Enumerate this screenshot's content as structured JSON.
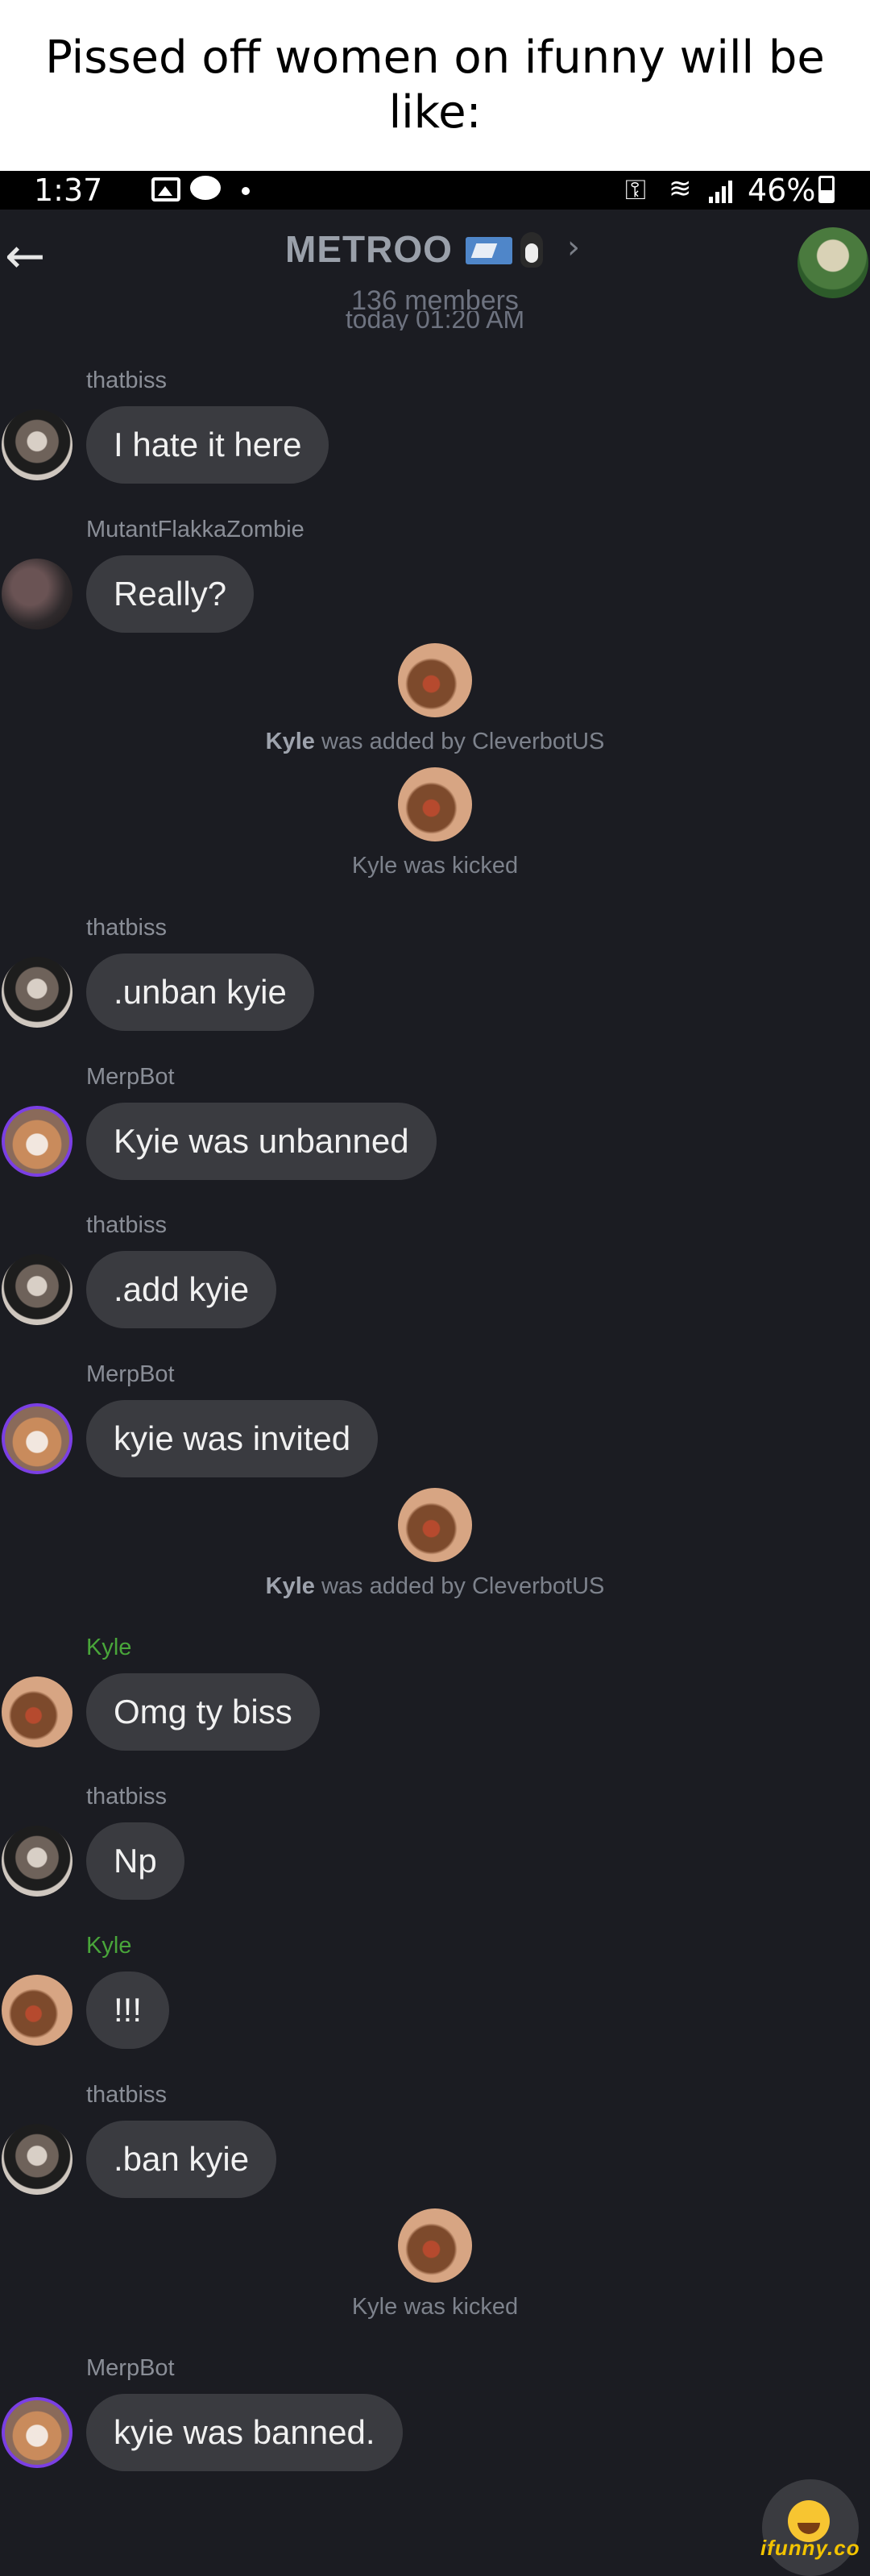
{
  "caption": "Pissed off women on ifunny will be like:",
  "status_bar": {
    "time": "1:37",
    "battery": "46%"
  },
  "header": {
    "back_glyph": "←",
    "title": "METROO",
    "members": "136 members",
    "date_peek": "today 01:20 AM"
  },
  "messages": [
    {
      "sender": "thatbiss",
      "text": "I hate it here"
    },
    {
      "sender": "MutantFlakkaZombie",
      "text": "Really?"
    },
    {
      "sender": "thatbiss",
      "text": ".unban kyie"
    },
    {
      "sender": "MerpBot",
      "text": "Kyie was unbanned"
    },
    {
      "sender": "thatbiss",
      "text": ".add kyie"
    },
    {
      "sender": "MerpBot",
      "text": "kyie was invited"
    },
    {
      "sender": "Kyle",
      "text": "Omg ty biss"
    },
    {
      "sender": "thatbiss",
      "text": "Np"
    },
    {
      "sender": "Kyle",
      "text": "!!!"
    },
    {
      "sender": "thatbiss",
      "text": ".ban kyie"
    },
    {
      "sender": "MerpBot",
      "text": "kyie was banned."
    }
  ],
  "system": [
    {
      "name": "Kyle",
      "text": "was added by CleverbotUS"
    },
    {
      "text": "Kyle was kicked"
    },
    {
      "name": "Kyle",
      "text": "was added by CleverbotUS"
    },
    {
      "text": "Kyle was kicked"
    }
  ],
  "watermark": "ifunny.co",
  "colors": {
    "background": "#1b1c22",
    "bubble": "#3a3b40",
    "kyle_name": "#49a63a",
    "merpbot_ring": "#7b3fe4"
  }
}
